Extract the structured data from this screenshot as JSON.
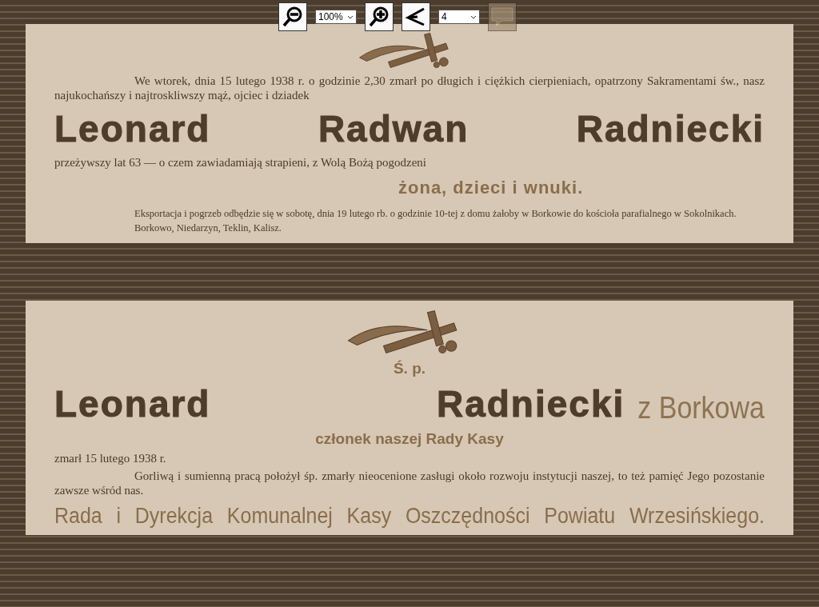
{
  "toolbar": {
    "zoom": "100%",
    "page": "4"
  },
  "notices": [
    {
      "blocks": [
        {
          "kind": "emblem"
        },
        {
          "kind": "lead",
          "text": "We wtorek, dnia 15 lutego 1938 r. o godzinie 2,30 zmarł po długich i ciężkich cierpieniach, opatrzony Sakramentami św., nasz najukochańszy i najtroskliwszy mąż, ojciec i dziadek"
        },
        {
          "kind": "name",
          "text": "Leonard Radwan Radniecki"
        },
        {
          "kind": "plain",
          "text": "przeżywszy lat 63 — o czem zawiadamiają strapieni, z Wolą Bożą pogodzeni"
        },
        {
          "kind": "signers",
          "text": "żona, dzieci i wnuki."
        },
        {
          "kind": "small",
          "text": "Eksportacja i pogrzeb odbędzie się w sobotę, dnia 19 lutego rb. o godzinie 10-tej z domu żałoby w Borkowie do kościoła parafialnego w Sokolnikach."
        },
        {
          "kind": "small",
          "text": "Borkowo, Niedarzyn, Teklin, Kalisz."
        }
      ]
    },
    {
      "blocks": [
        {
          "kind": "emblem"
        },
        {
          "kind": "heading",
          "text": "Ś. p."
        },
        {
          "kind": "name",
          "text": "Leonard Radniecki",
          "suffix": "z Borkowa"
        },
        {
          "kind": "heading",
          "text": "członek naszej Rady Kasy"
        },
        {
          "kind": "plain",
          "text": "zmarł 15 lutego 1938 r."
        },
        {
          "kind": "lead",
          "text": "Gorliwą i sumienną pracą położył śp. zmarły nieocenione zasługi około rozwoju instytucji naszej, to też pamięć Jego pozostanie zawsze wśród nas."
        },
        {
          "kind": "signature",
          "text": "Rada i Dyrekcja Komunalnej Kasy Oszczędności Powiatu Wrzesińskiego."
        }
      ]
    }
  ]
}
